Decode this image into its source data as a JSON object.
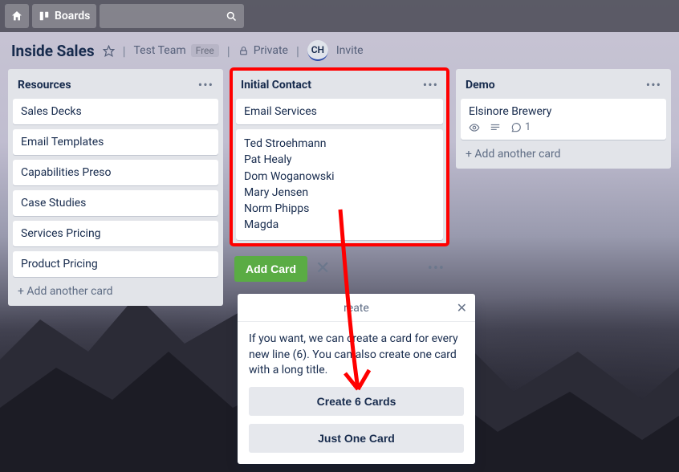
{
  "topbar": {
    "boards_label": "Boards"
  },
  "board_header": {
    "title": "Inside Sales",
    "team": "Test Team",
    "plan": "Free",
    "visibility": "Private",
    "avatar_initials": "CH",
    "invite": "Invite"
  },
  "lists": {
    "resources": {
      "title": "Resources",
      "cards": [
        "Sales Decks",
        "Email Templates",
        "Capabilities Preso",
        "Case Studies",
        "Services Pricing",
        "Product Pricing"
      ],
      "add": "Add another card"
    },
    "initial_contact": {
      "title": "Initial Contact",
      "compose_title": "Email Services",
      "compose_lines": [
        "Ted Stroehmann",
        "Pat Healy",
        "Dom Woganowski",
        "Mary Jensen",
        "Norm Phipps",
        "Magda"
      ],
      "add_card": "Add Card"
    },
    "demo": {
      "title": "Demo",
      "card_title": "Elsinore Brewery",
      "comment_count": "1",
      "add": "Add another card"
    }
  },
  "popup": {
    "title_suffix": "reate",
    "body": "If you want, we can create a card for every new line (6). You can also create one card with a long title.",
    "primary": "Create 6 Cards",
    "secondary": "Just One Card"
  }
}
